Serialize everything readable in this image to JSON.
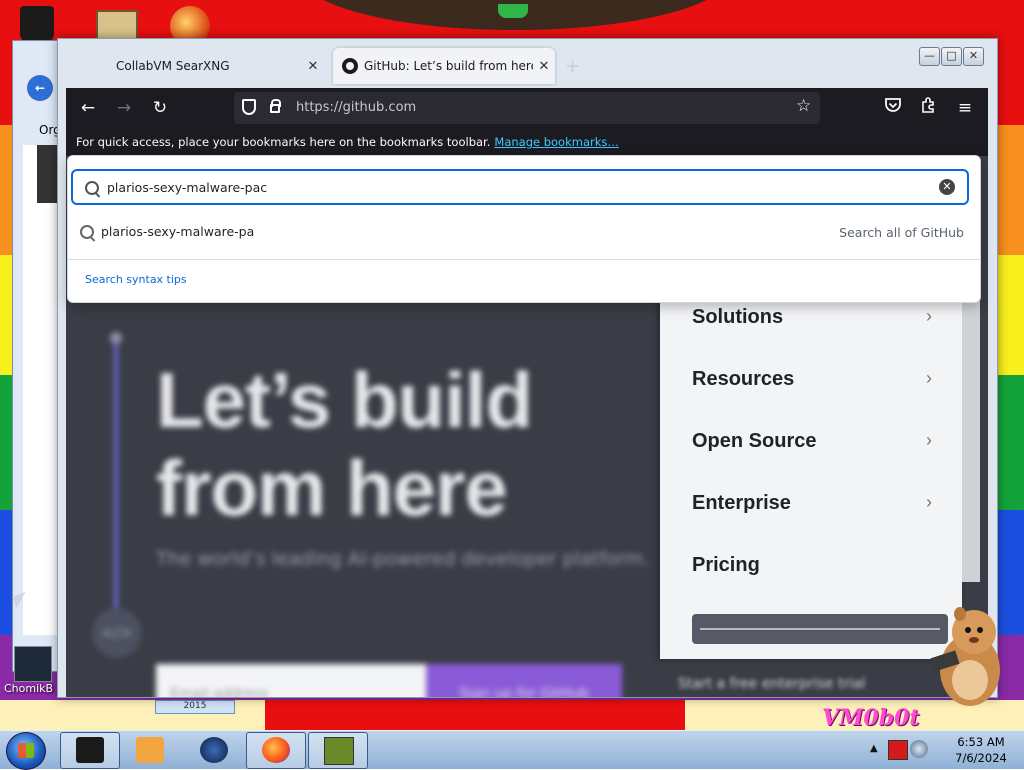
{
  "browser": {
    "tabs": [
      {
        "title": "CollabVM SearXNG",
        "close": "✕"
      },
      {
        "title": "GitHub: Let’s build from here · G",
        "close": "✕"
      }
    ],
    "new_tab": "+",
    "window_controls": {
      "minimize": "—",
      "maximize": "□",
      "close": "✕"
    },
    "url": "https://github.com",
    "bookmarks_hint": "For quick access, place your bookmarks here on the bookmarks toolbar.",
    "manage_bookmarks": "Manage bookmarks…"
  },
  "search": {
    "query": "plarios-sexy-malware-pac",
    "clear": "✕",
    "suggestion": "plarios-sexy-malware-pa",
    "suggestion_scope": "Search all of GitHub",
    "syntax_tips": "Search syntax tips"
  },
  "page": {
    "hero_title_1": "Let’s build",
    "hero_title_2": "from here",
    "hero_subtitle": "The world’s leading AI-powered developer platform.",
    "email_placeholder": "Email address",
    "signup_button": "Sign up for GitHub",
    "enterprise_button": "Start a free enterprise trial",
    "nav": [
      {
        "label": "Solutions",
        "chevron": "›"
      },
      {
        "label": "Resources",
        "chevron": "›"
      },
      {
        "label": "Open Source",
        "chevron": "›"
      },
      {
        "label": "Enterprise",
        "chevron": "›"
      },
      {
        "label": "Pricing"
      }
    ]
  },
  "desktop": {
    "explorer_label": "Org",
    "chomik_label": "ChomikB",
    "bottom_box": "2015",
    "watermark": "VM0b0t"
  },
  "taskbar": {
    "time": "6:53 AM",
    "date": "7/6/2024",
    "tray_arrow": "▲"
  },
  "colors": {
    "accent_blue": "#0969da",
    "browser_toolbar": "#1c1b22",
    "link_cyan": "#3fc8ff",
    "signup_purple": "#8a5bd6"
  }
}
